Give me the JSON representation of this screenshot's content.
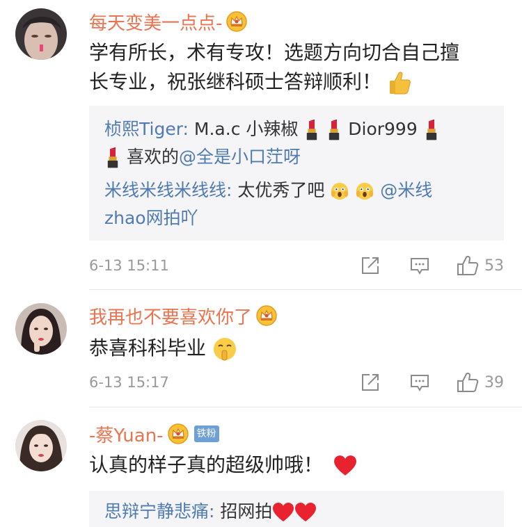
{
  "comments": [
    {
      "username": "每天变美一点点-",
      "text_part1": "学有所长，术有专攻！选题方向切合自己擅",
      "text_part2": "长专业，祝张继科硕士答辩顺利！",
      "replies": [
        {
          "name": "桢熙Tiger:",
          "text_a": " M.a.c 小辣椒",
          "text_b": " Dior999 ",
          "text_c": " 喜欢的",
          "mention": "@全是小口茳呀"
        },
        {
          "name": "米线米线米线线:",
          "text_a": " 太优秀了吧",
          "mention_a": "@米线",
          "mention_b": "zhao网拍吖"
        }
      ],
      "time": "6-13 15:11",
      "likes": "53"
    },
    {
      "username": "我再也不要喜欢你了",
      "text": "恭喜科科毕业",
      "time": "6-13 15:17",
      "likes": "39"
    },
    {
      "username": "-蔡Yuan-",
      "fan_badge": "铁粉",
      "text": "认真的样子真的超级帅哦！",
      "replies": [
        {
          "name": "思辩宁静悲痛:",
          "text_a": " 招网拍"
        }
      ]
    }
  ],
  "colors": {
    "username": "#eb7350",
    "link": "#4f7bb3",
    "meta": "#999999",
    "reply_bg": "#f5f5f7"
  },
  "icons": [
    "crown-badge-icon",
    "thumbs-up-emoji",
    "lipstick-emoji",
    "screaming-face-emoji",
    "shushing-face-emoji",
    "red-heart-emoji",
    "share-icon",
    "comment-icon",
    "like-icon"
  ]
}
